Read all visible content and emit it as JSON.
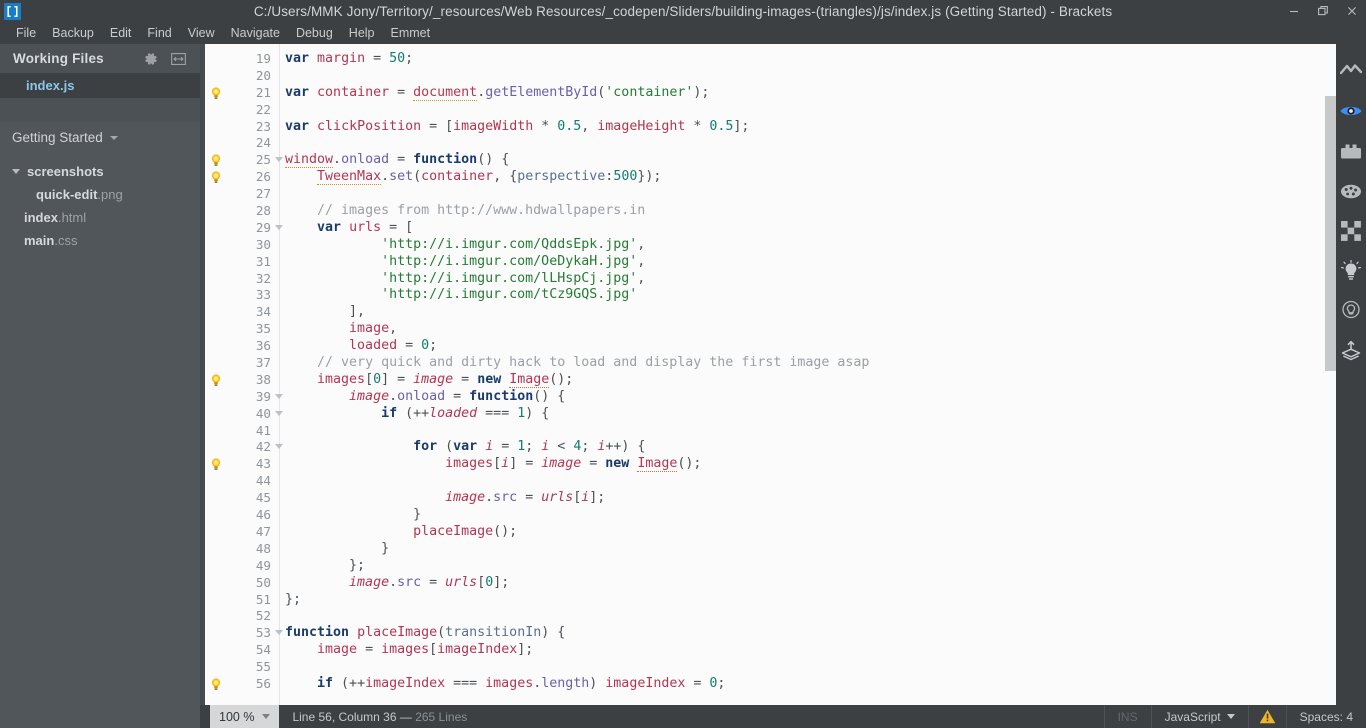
{
  "window": {
    "title": "C:/Users/MMK Jony/Territory/_resources/Web Resources/_codepen/Sliders/building-images-(triangles)/js/index.js (Getting Started) - Brackets",
    "logo_icon": "brackets-logo-icon",
    "controls": [
      {
        "name": "minimize-button",
        "icon": "minimize-icon"
      },
      {
        "name": "restore-button",
        "icon": "restore-icon"
      },
      {
        "name": "close-button",
        "icon": "close-icon"
      }
    ]
  },
  "menubar": {
    "items": [
      "File",
      "Backup",
      "Edit",
      "Find",
      "View",
      "Navigate",
      "Debug",
      "Help",
      "Emmet"
    ]
  },
  "sidebar": {
    "working_files": {
      "title": "Working Files",
      "gear_icon": "gear-icon",
      "split_icon": "split-view-icon",
      "files": [
        {
          "base": "index",
          "ext": ".js",
          "selected": true
        }
      ]
    },
    "project": {
      "name": "Getting Started",
      "caret_icon": "chevron-down-icon",
      "tree": [
        {
          "type": "folder",
          "base": "screenshots",
          "ext": "",
          "level": 0,
          "expanded": true
        },
        {
          "type": "file",
          "base": "quick-edit",
          "ext": ".png",
          "level": 1
        },
        {
          "type": "file",
          "base": "index",
          "ext": ".html",
          "level": 0
        },
        {
          "type": "file",
          "base": "main",
          "ext": ".css",
          "level": 0
        }
      ]
    }
  },
  "editor": {
    "first_line": 19,
    "lines": [
      {
        "n": 19,
        "bulb": false,
        "fold": false,
        "tokens": [
          {
            "t": "var",
            "c": "kw"
          },
          {
            "t": " ",
            "c": "op"
          },
          {
            "t": "margin",
            "c": "id"
          },
          {
            "t": " = ",
            "c": "op"
          },
          {
            "t": "50",
            "c": "num"
          },
          {
            "t": ";",
            "c": "op"
          }
        ]
      },
      {
        "n": 20,
        "bulb": false,
        "fold": false,
        "tokens": []
      },
      {
        "n": 21,
        "bulb": true,
        "fold": false,
        "tokens": [
          {
            "t": "var",
            "c": "kw"
          },
          {
            "t": " ",
            "c": "op"
          },
          {
            "t": "container",
            "c": "id"
          },
          {
            "t": " = ",
            "c": "op"
          },
          {
            "t": "document",
            "c": "id undl"
          },
          {
            "t": ".",
            "c": "op"
          },
          {
            "t": "getElementById",
            "c": "prop"
          },
          {
            "t": "(",
            "c": "op"
          },
          {
            "t": "'container'",
            "c": "str"
          },
          {
            "t": ");",
            "c": "op"
          }
        ]
      },
      {
        "n": 22,
        "bulb": false,
        "fold": false,
        "tokens": []
      },
      {
        "n": 23,
        "bulb": false,
        "fold": false,
        "tokens": [
          {
            "t": "var",
            "c": "kw"
          },
          {
            "t": " ",
            "c": "op"
          },
          {
            "t": "clickPosition",
            "c": "id"
          },
          {
            "t": " = [",
            "c": "op"
          },
          {
            "t": "imageWidth",
            "c": "id"
          },
          {
            "t": " * ",
            "c": "op"
          },
          {
            "t": "0.5",
            "c": "num"
          },
          {
            "t": ", ",
            "c": "op"
          },
          {
            "t": "imageHeight",
            "c": "id"
          },
          {
            "t": " * ",
            "c": "op"
          },
          {
            "t": "0.5",
            "c": "num"
          },
          {
            "t": "];",
            "c": "op"
          }
        ]
      },
      {
        "n": 24,
        "bulb": false,
        "fold": false,
        "tokens": []
      },
      {
        "n": 25,
        "bulb": true,
        "fold": true,
        "tokens": [
          {
            "t": "window",
            "c": "id undl"
          },
          {
            "t": ".",
            "c": "op"
          },
          {
            "t": "onload",
            "c": "prop"
          },
          {
            "t": " = ",
            "c": "op"
          },
          {
            "t": "function",
            "c": "kw"
          },
          {
            "t": "() {",
            "c": "op"
          }
        ]
      },
      {
        "n": 26,
        "bulb": true,
        "fold": false,
        "tokens": [
          {
            "t": "    ",
            "c": "op"
          },
          {
            "t": "TweenMax",
            "c": "id undl"
          },
          {
            "t": ".",
            "c": "op"
          },
          {
            "t": "set",
            "c": "prop"
          },
          {
            "t": "(",
            "c": "op"
          },
          {
            "t": "container",
            "c": "id"
          },
          {
            "t": ", {",
            "c": "op"
          },
          {
            "t": "perspective",
            "c": "prm"
          },
          {
            "t": ":",
            "c": "op"
          },
          {
            "t": "500",
            "c": "num"
          },
          {
            "t": "});",
            "c": "op"
          }
        ]
      },
      {
        "n": 27,
        "bulb": false,
        "fold": false,
        "tokens": []
      },
      {
        "n": 28,
        "bulb": false,
        "fold": false,
        "tokens": [
          {
            "t": "    ",
            "c": "op"
          },
          {
            "t": "// images from http://www.hdwallpapers.in",
            "c": "com"
          }
        ]
      },
      {
        "n": 29,
        "bulb": false,
        "fold": true,
        "tokens": [
          {
            "t": "    ",
            "c": "op"
          },
          {
            "t": "var",
            "c": "kw"
          },
          {
            "t": " ",
            "c": "op"
          },
          {
            "t": "urls",
            "c": "id"
          },
          {
            "t": " = [",
            "c": "op"
          }
        ]
      },
      {
        "n": 30,
        "bulb": false,
        "fold": false,
        "tokens": [
          {
            "t": "            ",
            "c": "op"
          },
          {
            "t": "'http://i.imgur.com/QddsEpk.jpg'",
            "c": "str"
          },
          {
            "t": ",",
            "c": "op"
          }
        ]
      },
      {
        "n": 31,
        "bulb": false,
        "fold": false,
        "tokens": [
          {
            "t": "            ",
            "c": "op"
          },
          {
            "t": "'http://i.imgur.com/OeDykaH.jpg'",
            "c": "str"
          },
          {
            "t": ",",
            "c": "op"
          }
        ]
      },
      {
        "n": 32,
        "bulb": false,
        "fold": false,
        "tokens": [
          {
            "t": "            ",
            "c": "op"
          },
          {
            "t": "'http://i.imgur.com/lLHspCj.jpg'",
            "c": "str"
          },
          {
            "t": ",",
            "c": "op"
          }
        ]
      },
      {
        "n": 33,
        "bulb": false,
        "fold": false,
        "tokens": [
          {
            "t": "            ",
            "c": "op"
          },
          {
            "t": "'http://i.imgur.com/tCz9GQS.jpg'",
            "c": "str"
          }
        ]
      },
      {
        "n": 34,
        "bulb": false,
        "fold": false,
        "tokens": [
          {
            "t": "        ],",
            "c": "op"
          }
        ]
      },
      {
        "n": 35,
        "bulb": false,
        "fold": false,
        "tokens": [
          {
            "t": "        ",
            "c": "op"
          },
          {
            "t": "image",
            "c": "id"
          },
          {
            "t": ",",
            "c": "op"
          }
        ]
      },
      {
        "n": 36,
        "bulb": false,
        "fold": false,
        "tokens": [
          {
            "t": "        ",
            "c": "op"
          },
          {
            "t": "loaded",
            "c": "id"
          },
          {
            "t": " = ",
            "c": "op"
          },
          {
            "t": "0",
            "c": "num"
          },
          {
            "t": ";",
            "c": "op"
          }
        ]
      },
      {
        "n": 37,
        "bulb": false,
        "fold": false,
        "tokens": [
          {
            "t": "    ",
            "c": "op"
          },
          {
            "t": "// very quick and dirty hack to load and display the first image asap",
            "c": "com"
          }
        ]
      },
      {
        "n": 38,
        "bulb": true,
        "fold": false,
        "tokens": [
          {
            "t": "    ",
            "c": "op"
          },
          {
            "t": "images",
            "c": "id"
          },
          {
            "t": "[",
            "c": "op"
          },
          {
            "t": "0",
            "c": "num"
          },
          {
            "t": "] = ",
            "c": "op"
          },
          {
            "t": "image",
            "c": "loc"
          },
          {
            "t": " = ",
            "c": "op"
          },
          {
            "t": "new",
            "c": "kw"
          },
          {
            "t": " ",
            "c": "op"
          },
          {
            "t": "Image",
            "c": "id undl2"
          },
          {
            "t": "();",
            "c": "op"
          }
        ]
      },
      {
        "n": 39,
        "bulb": false,
        "fold": true,
        "tokens": [
          {
            "t": "        ",
            "c": "op"
          },
          {
            "t": "image",
            "c": "loc"
          },
          {
            "t": ".",
            "c": "op"
          },
          {
            "t": "onload",
            "c": "prop"
          },
          {
            "t": " = ",
            "c": "op"
          },
          {
            "t": "function",
            "c": "kw"
          },
          {
            "t": "() {",
            "c": "op"
          }
        ]
      },
      {
        "n": 40,
        "bulb": false,
        "fold": true,
        "tokens": [
          {
            "t": "            ",
            "c": "op"
          },
          {
            "t": "if",
            "c": "kw"
          },
          {
            "t": " (++",
            "c": "op"
          },
          {
            "t": "loaded",
            "c": "loc"
          },
          {
            "t": " === ",
            "c": "op"
          },
          {
            "t": "1",
            "c": "num"
          },
          {
            "t": ") {",
            "c": "op"
          }
        ]
      },
      {
        "n": 41,
        "bulb": false,
        "fold": false,
        "tokens": []
      },
      {
        "n": 42,
        "bulb": false,
        "fold": true,
        "tokens": [
          {
            "t": "                ",
            "c": "op"
          },
          {
            "t": "for",
            "c": "kw"
          },
          {
            "t": " (",
            "c": "op"
          },
          {
            "t": "var",
            "c": "kw"
          },
          {
            "t": " ",
            "c": "op"
          },
          {
            "t": "i",
            "c": "loc"
          },
          {
            "t": " = ",
            "c": "op"
          },
          {
            "t": "1",
            "c": "num"
          },
          {
            "t": "; ",
            "c": "op"
          },
          {
            "t": "i",
            "c": "loc"
          },
          {
            "t": " < ",
            "c": "op"
          },
          {
            "t": "4",
            "c": "num"
          },
          {
            "t": "; ",
            "c": "op"
          },
          {
            "t": "i",
            "c": "loc"
          },
          {
            "t": "++) {",
            "c": "op"
          }
        ]
      },
      {
        "n": 43,
        "bulb": true,
        "fold": false,
        "tokens": [
          {
            "t": "                    ",
            "c": "op"
          },
          {
            "t": "images",
            "c": "id"
          },
          {
            "t": "[",
            "c": "op"
          },
          {
            "t": "i",
            "c": "loc"
          },
          {
            "t": "] = ",
            "c": "op"
          },
          {
            "t": "image",
            "c": "loc"
          },
          {
            "t": " = ",
            "c": "op"
          },
          {
            "t": "new",
            "c": "kw"
          },
          {
            "t": " ",
            "c": "op"
          },
          {
            "t": "Image",
            "c": "id undl2"
          },
          {
            "t": "();",
            "c": "op"
          }
        ]
      },
      {
        "n": 44,
        "bulb": false,
        "fold": false,
        "tokens": []
      },
      {
        "n": 45,
        "bulb": false,
        "fold": false,
        "tokens": [
          {
            "t": "                    ",
            "c": "op"
          },
          {
            "t": "image",
            "c": "loc"
          },
          {
            "t": ".",
            "c": "op"
          },
          {
            "t": "src",
            "c": "prop"
          },
          {
            "t": " = ",
            "c": "op"
          },
          {
            "t": "urls",
            "c": "loc"
          },
          {
            "t": "[",
            "c": "op"
          },
          {
            "t": "i",
            "c": "loc"
          },
          {
            "t": "];",
            "c": "op"
          }
        ]
      },
      {
        "n": 46,
        "bulb": false,
        "fold": false,
        "tokens": [
          {
            "t": "                }",
            "c": "op"
          }
        ]
      },
      {
        "n": 47,
        "bulb": false,
        "fold": false,
        "tokens": [
          {
            "t": "                ",
            "c": "op"
          },
          {
            "t": "placeImage",
            "c": "id"
          },
          {
            "t": "();",
            "c": "op"
          }
        ]
      },
      {
        "n": 48,
        "bulb": false,
        "fold": false,
        "tokens": [
          {
            "t": "            }",
            "c": "op"
          }
        ]
      },
      {
        "n": 49,
        "bulb": false,
        "fold": false,
        "tokens": [
          {
            "t": "        };",
            "c": "op"
          }
        ]
      },
      {
        "n": 50,
        "bulb": false,
        "fold": false,
        "tokens": [
          {
            "t": "        ",
            "c": "op"
          },
          {
            "t": "image",
            "c": "loc"
          },
          {
            "t": ".",
            "c": "op"
          },
          {
            "t": "src",
            "c": "prop"
          },
          {
            "t": " = ",
            "c": "op"
          },
          {
            "t": "urls",
            "c": "loc"
          },
          {
            "t": "[",
            "c": "op"
          },
          {
            "t": "0",
            "c": "num"
          },
          {
            "t": "];",
            "c": "op"
          }
        ]
      },
      {
        "n": 51,
        "bulb": false,
        "fold": false,
        "tokens": [
          {
            "t": "};",
            "c": "op"
          }
        ]
      },
      {
        "n": 52,
        "bulb": false,
        "fold": false,
        "tokens": []
      },
      {
        "n": 53,
        "bulb": false,
        "fold": true,
        "tokens": [
          {
            "t": "function",
            "c": "kw"
          },
          {
            "t": " ",
            "c": "op"
          },
          {
            "t": "placeImage",
            "c": "id"
          },
          {
            "t": "(",
            "c": "op"
          },
          {
            "t": "transitionIn",
            "c": "prm"
          },
          {
            "t": ") {",
            "c": "op"
          }
        ]
      },
      {
        "n": 54,
        "bulb": false,
        "fold": false,
        "tokens": [
          {
            "t": "    ",
            "c": "op"
          },
          {
            "t": "image",
            "c": "id"
          },
          {
            "t": " = ",
            "c": "op"
          },
          {
            "t": "images",
            "c": "id"
          },
          {
            "t": "[",
            "c": "op"
          },
          {
            "t": "imageIndex",
            "c": "id"
          },
          {
            "t": "];",
            "c": "op"
          }
        ]
      },
      {
        "n": 55,
        "bulb": false,
        "fold": false,
        "tokens": []
      },
      {
        "n": 56,
        "bulb": true,
        "fold": false,
        "tokens": [
          {
            "t": "    ",
            "c": "op"
          },
          {
            "t": "if",
            "c": "kw"
          },
          {
            "t": " (++",
            "c": "op"
          },
          {
            "t": "imageIndex",
            "c": "id"
          },
          {
            "t": " === ",
            "c": "op"
          },
          {
            "t": "images",
            "c": "id"
          },
          {
            "t": ".",
            "c": "op"
          },
          {
            "t": "length",
            "c": "prop"
          },
          {
            "t": ") ",
            "c": "op"
          },
          {
            "t": "imageIndex",
            "c": "id"
          },
          {
            "t": " = ",
            "c": "op"
          },
          {
            "t": "0",
            "c": "num"
          },
          {
            "t": ";",
            "c": "op"
          }
        ]
      }
    ]
  },
  "right_toolbar": {
    "icons": [
      {
        "name": "live-preview-icon",
        "active": false
      },
      {
        "name": "eye-icon",
        "active": true
      },
      {
        "name": "toolbox-icon",
        "active": false
      },
      {
        "name": "palette-icon",
        "active": false
      },
      {
        "name": "checkerboard-icon",
        "active": false
      },
      {
        "name": "lightbulb-on-icon",
        "active": false
      },
      {
        "name": "lightbulb-off-icon",
        "active": false
      },
      {
        "name": "layers-upload-icon",
        "active": false
      }
    ]
  },
  "statusbar": {
    "zoom": "100 %",
    "zoom_caret_icon": "chevron-down-icon",
    "cursor": "Line 56, Column 36 — ",
    "line_count": "265 Lines",
    "ins": "INS",
    "language": "JavaScript",
    "language_caret_icon": "chevron-down-icon",
    "warning_icon": "warning-triangle-icon",
    "indent": "Spaces: 4"
  },
  "colors": {
    "chrome": "#3c4043",
    "sidebar": "#51565a",
    "editor_bg": "#fbfbfb",
    "accent_blue": "#8cc6e8",
    "active_icon": "#3d8ef5",
    "warning": "#f0b429"
  }
}
